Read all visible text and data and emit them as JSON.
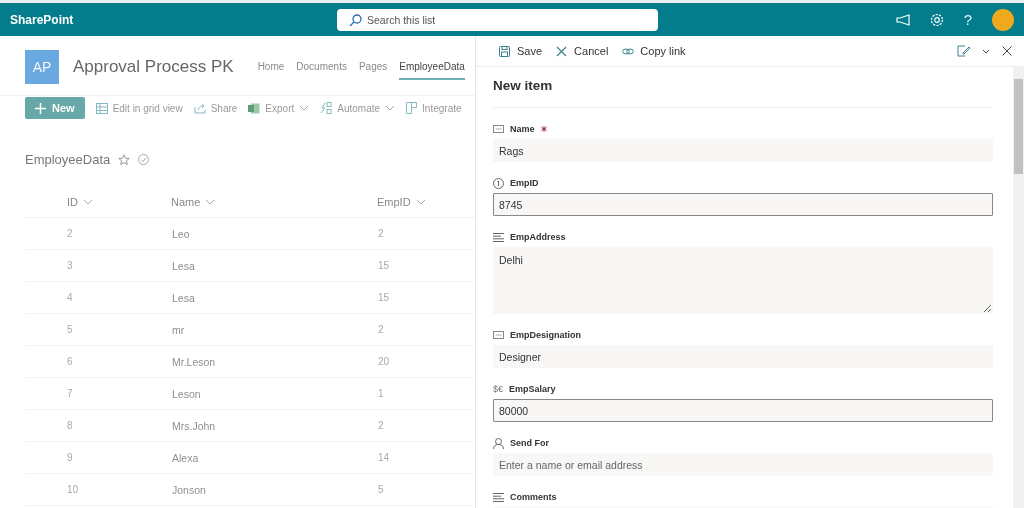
{
  "app": {
    "name": "SharePoint"
  },
  "search": {
    "placeholder": "Search this list"
  },
  "header_actions": [
    {
      "kind": "megaphone"
    },
    {
      "kind": "settings"
    },
    {
      "kind": "help",
      "label": "?"
    },
    {
      "kind": "avatar"
    }
  ],
  "site": {
    "logo": "AP",
    "title": "Approval Process PK",
    "nav": [
      {
        "label": "Home",
        "selected": false
      },
      {
        "label": "Documents",
        "selected": false
      },
      {
        "label": "Pages",
        "selected": false
      },
      {
        "label": "EmployeeData",
        "selected": true
      }
    ]
  },
  "commands": [
    {
      "label": "New",
      "kind": "new"
    },
    {
      "label": "Edit in grid view",
      "kind": "grid"
    },
    {
      "label": "Share",
      "kind": "share"
    },
    {
      "label": "Export",
      "kind": "excel",
      "dropdown": true
    },
    {
      "label": "Automate",
      "kind": "automate",
      "dropdown": true
    },
    {
      "label": "Integrate",
      "kind": "integrate"
    }
  ],
  "list": {
    "title": "EmployeeData",
    "favorite": false,
    "columns": [
      "ID",
      "Name",
      "EmpID"
    ],
    "rows": [
      [
        "2",
        "Leo",
        "2"
      ],
      [
        "3",
        "Lesa",
        "15"
      ],
      [
        "4",
        "Lesa",
        "15"
      ],
      [
        "5",
        "mr",
        "2"
      ],
      [
        "6",
        "Mr.Leson",
        "20"
      ],
      [
        "7",
        "Leson",
        "1"
      ],
      [
        "8",
        "Mrs.John",
        "2"
      ],
      [
        "9",
        "Alexa",
        "14"
      ],
      [
        "10",
        "Jonson",
        "5"
      ]
    ]
  },
  "panel": {
    "actions": [
      {
        "label": "Save",
        "kind": "save"
      },
      {
        "label": "Cancel",
        "kind": "cancel"
      },
      {
        "label": "Copy link",
        "kind": "link"
      }
    ],
    "title": "New item",
    "fields": [
      {
        "label": "Name",
        "kind": "text",
        "required": true,
        "value": "Rags"
      },
      {
        "label": "EmpID",
        "kind": "number",
        "required": false,
        "value": "8745"
      },
      {
        "label": "EmpAddress",
        "kind": "multiline",
        "required": false,
        "value": "Delhi"
      },
      {
        "label": "EmpDesignation",
        "kind": "text",
        "required": false,
        "value": "Designer"
      },
      {
        "label": "EmpSalary",
        "kind": "currency",
        "symbol": "$€",
        "required": false,
        "value": "80000"
      },
      {
        "label": "Send For",
        "kind": "person",
        "required": false,
        "placeholder": "Enter a name or email address"
      },
      {
        "label": "Comments",
        "kind": "multiline",
        "required": false
      }
    ]
  }
}
